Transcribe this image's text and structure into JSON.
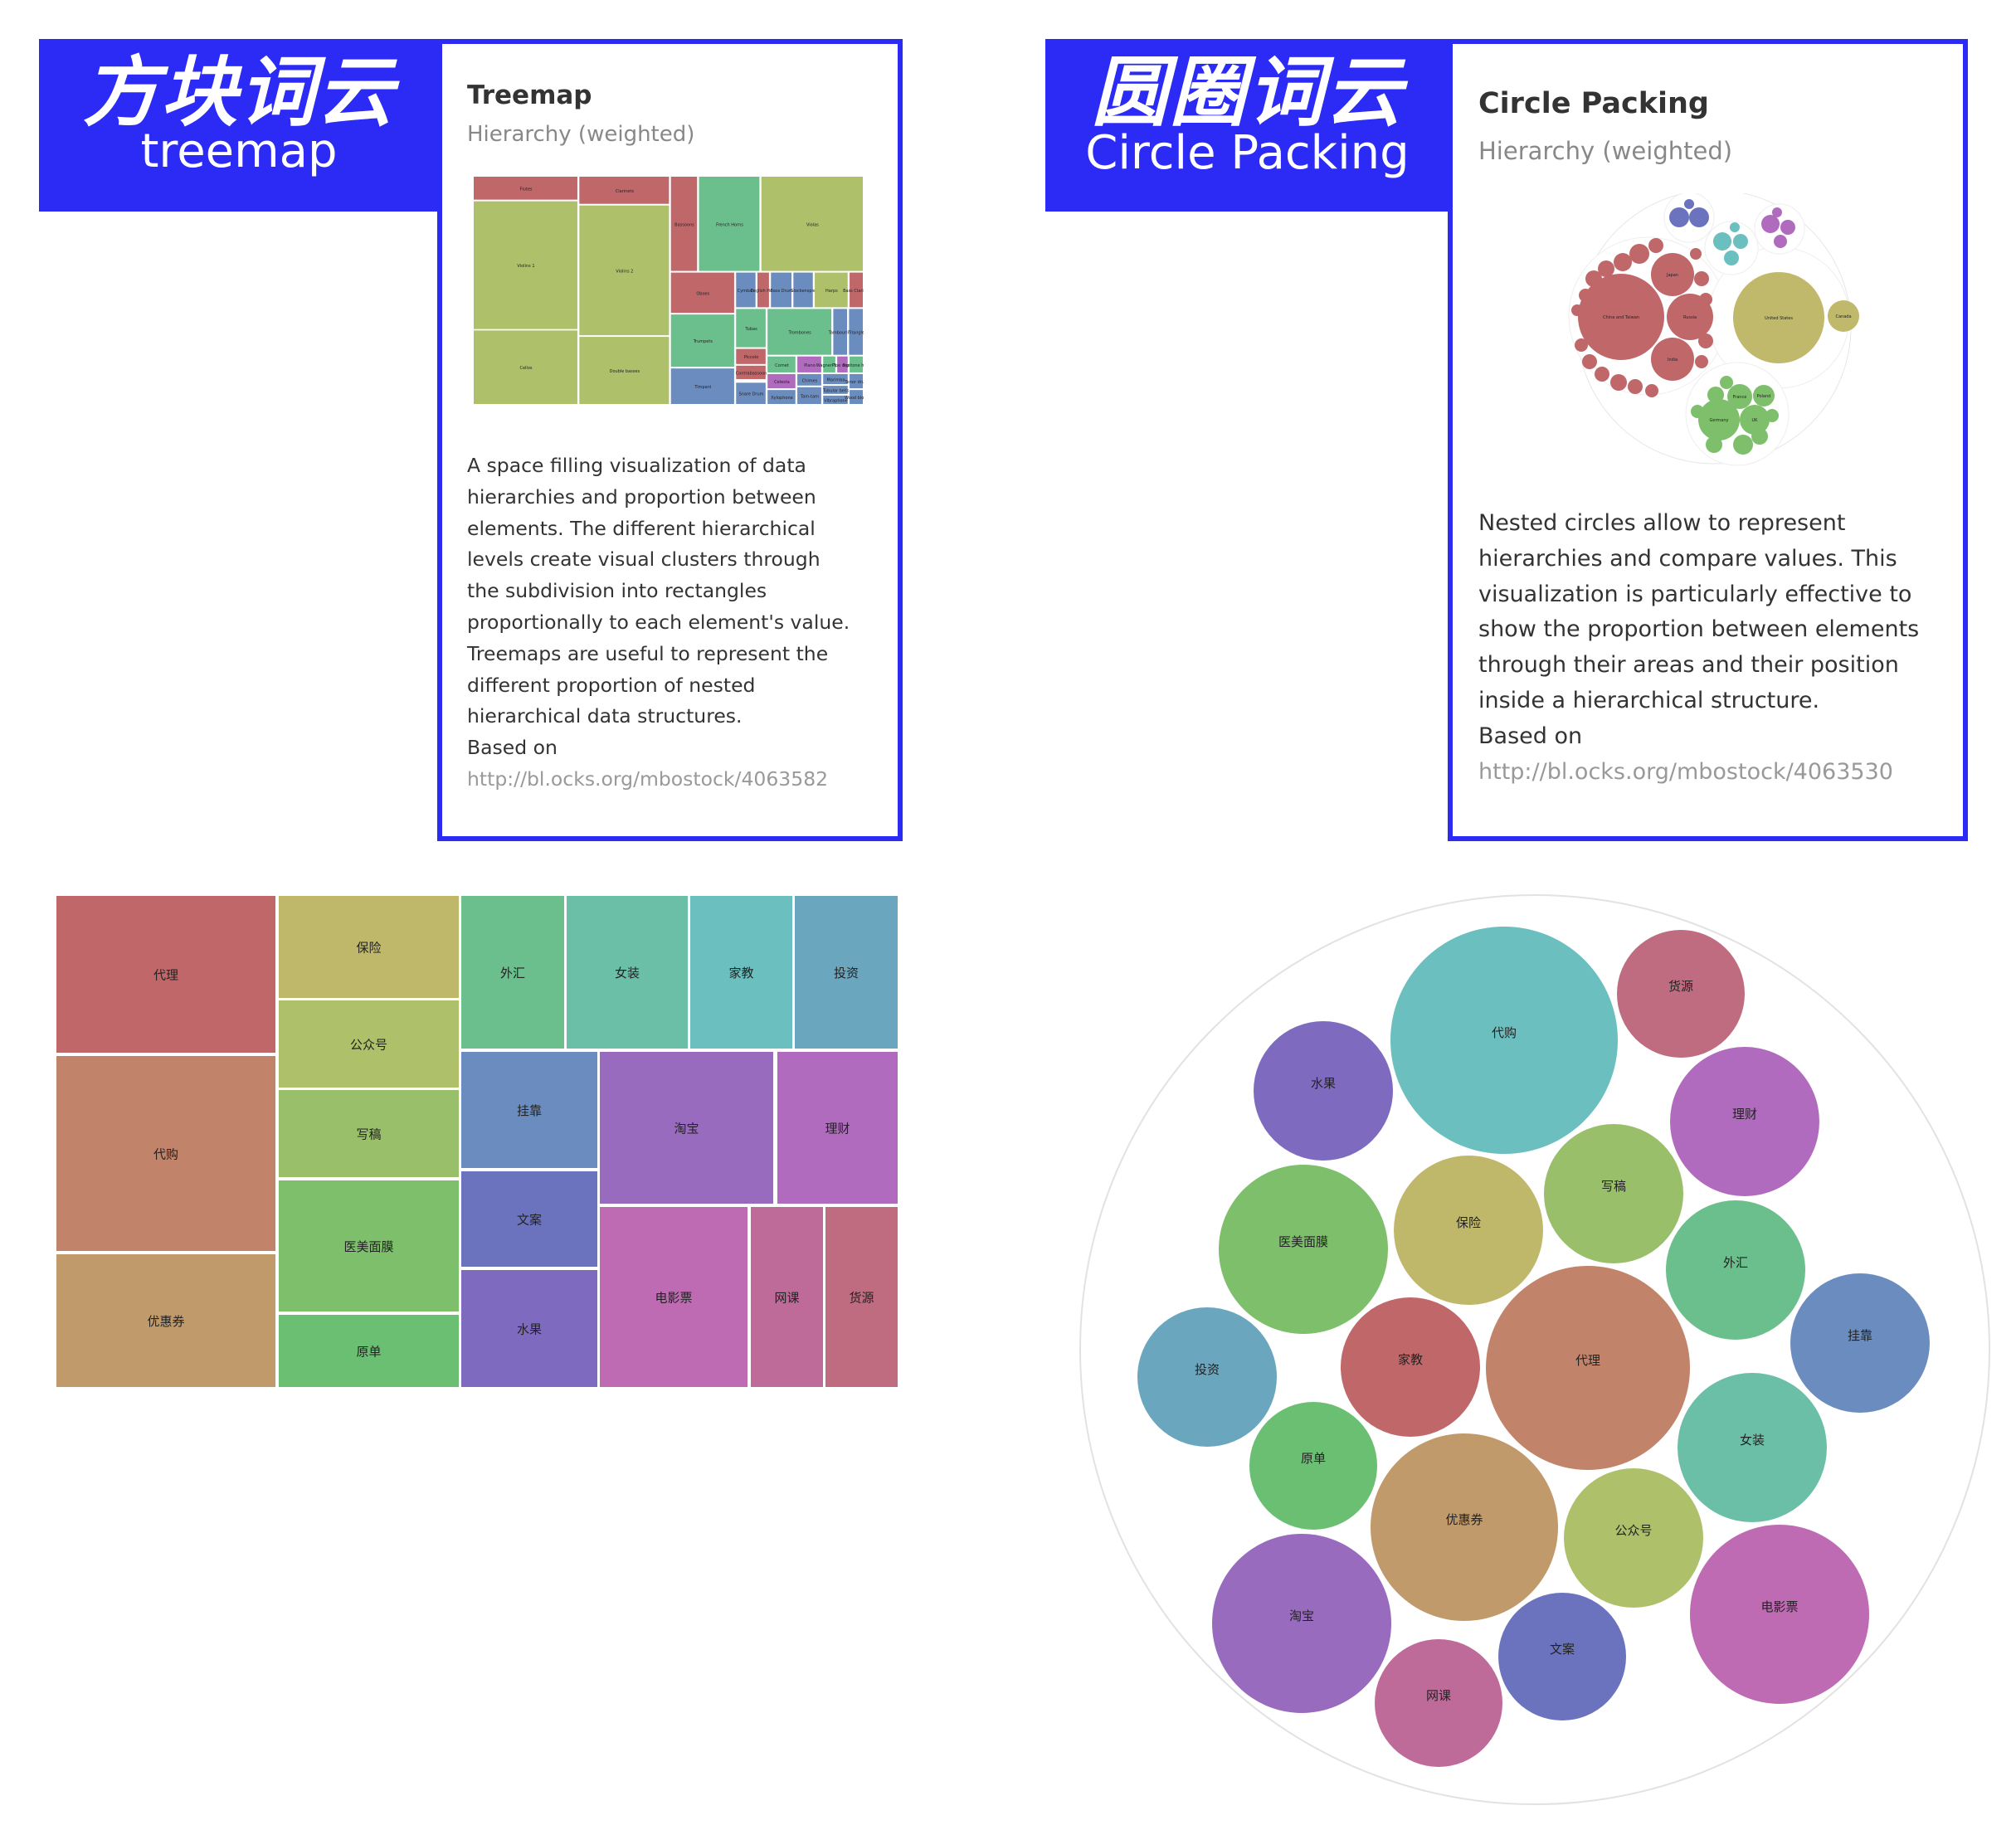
{
  "treemap_panel": {
    "header_zh": "方块词云",
    "header_en": "treemap",
    "title": "Treemap",
    "subtitle": "Hierarchy (weighted)",
    "description_lines": [
      "A space filling visualization of data",
      "hierarchies and proportion between",
      "elements. The different hierarchical",
      "levels create visual clusters through",
      "the subdivision into rectangles",
      "proportionally to each element's value.",
      "Treemaps are useful to represent the",
      "different proportion of nested",
      "hierarchical data structures."
    ],
    "based_on": "Based on",
    "link": "http://bl.ocks.org/mbostock/4063582",
    "thumbnail_labels": [
      "Flutes",
      "Violins 1",
      "Cellos",
      "Clarinets",
      "Violins 2",
      "Double basses",
      "Bassoons",
      "French Horns",
      "Violas",
      "Oboes",
      "Cymbals",
      "English Horn",
      "Bass Drum",
      "Glockenspiel",
      "Harps",
      "Bass Clarinet",
      "Trumpets",
      "Timpani",
      "Tubas",
      "Piccolo",
      "Contrabassoon",
      "Snare Drum",
      "Trombones",
      "Tambourine",
      "Triangle",
      "Cornet",
      "Piano",
      "Wagner Tuba",
      "Pipe organ",
      "Baritone horn",
      "Celesta",
      "Xylophone",
      "Chimes",
      "Tam-tam",
      "Marimba",
      "Tubular bells",
      "Vibraphone",
      "Tenor drum",
      "Wood block"
    ]
  },
  "circle_panel": {
    "header_zh": "圆圈词云",
    "header_en": "Circle Packing",
    "title": "Circle Packing",
    "subtitle": "Hierarchy (weighted)",
    "description_lines": [
      "Nested circles allow to represent",
      "hierarchies and compare values. This",
      "visualization is particularly effective to",
      "show the proportion between elements",
      "through their areas and their position",
      "inside a hierarchical structure."
    ],
    "based_on": "Based on",
    "link": "http://bl.ocks.org/mbostock/4063530",
    "thumbnail_labels": [
      "China and Taiwan",
      "Russia",
      "Japan",
      "India",
      "United States",
      "Canada",
      "Germany",
      "UK",
      "France",
      "Poland"
    ]
  },
  "colors": {
    "brand_blue": "#2b2bf5"
  },
  "chart_data": [
    {
      "type": "treemap",
      "labels": [
        "代理",
        "代购",
        "优惠券",
        "保险",
        "公众号",
        "写稿",
        "医美面膜",
        "原单",
        "外汇",
        "女装",
        "家教",
        "投资",
        "挂靠",
        "文案",
        "水果",
        "淘宝",
        "理财",
        "电影票",
        "网课",
        "货源"
      ],
      "colors": [
        "#c0676a",
        "#c1836a",
        "#c19a6b",
        "#bfb86b",
        "#afc06b",
        "#99bf6a",
        "#7ebf6b",
        "#6bbf73",
        "#6bbf8c",
        "#6bbfa6",
        "#6bbfbf",
        "#6ba6bf",
        "#6b8cbf",
        "#6b73bf",
        "#7e6bbf",
        "#996bbf",
        "#b06bbf",
        "#bf6bb4",
        "#bf6b9a",
        "#bf6b80"
      ]
    },
    {
      "type": "circle-packing",
      "labels": [
        "代购",
        "货源",
        "水果",
        "理财",
        "写稿",
        "保险",
        "医美面膜",
        "外汇",
        "挂靠",
        "投资",
        "家教",
        "代理",
        "女装",
        "原单",
        "优惠券",
        "公众号",
        "淘宝",
        "电影票",
        "文案",
        "网课"
      ],
      "colors": [
        "#6bbfbf",
        "#bf6b80",
        "#7e6bbf",
        "#b06bbf",
        "#99bf6a",
        "#bfb86b",
        "#7ebf6b",
        "#6bbf8c",
        "#6b8cbf",
        "#6ba6bf",
        "#c0676a",
        "#c1836a",
        "#6bbfa6",
        "#6bbf73",
        "#c19a6b",
        "#afc06b",
        "#996bbf",
        "#bf6bb4",
        "#6b73bf",
        "#bf6b9a"
      ]
    }
  ]
}
